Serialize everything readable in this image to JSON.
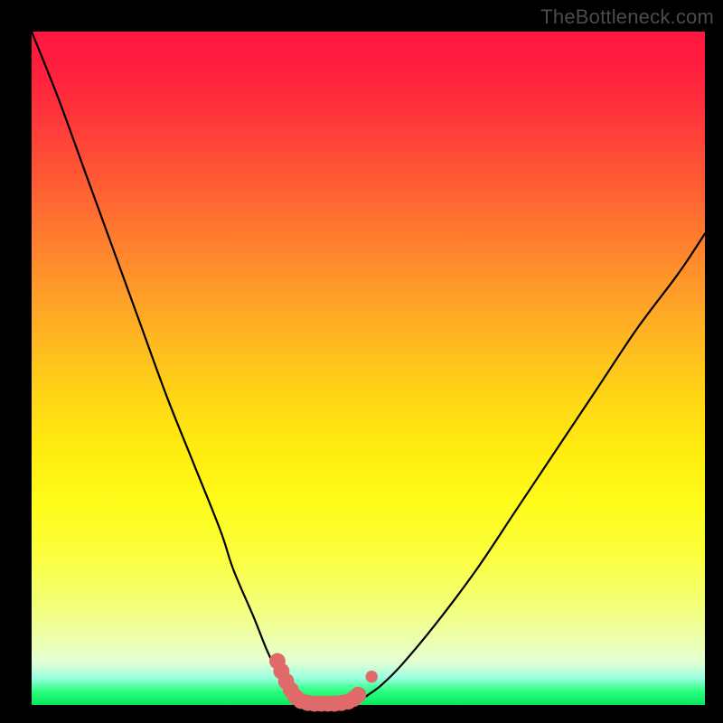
{
  "watermark": {
    "text": "TheBottleneck.com"
  },
  "colors": {
    "curve_stroke": "#000000",
    "marker_stroke": "#e06a6a",
    "marker_fill": "#e06a6a",
    "gradient_top": "#ff173f",
    "gradient_bottom": "#08e85e"
  },
  "chart_data": {
    "type": "line",
    "title": "",
    "xlabel": "",
    "ylabel": "",
    "xlim": [
      0,
      100
    ],
    "ylim": [
      0,
      100
    ],
    "grid": false,
    "legend": false,
    "series": [
      {
        "name": "left-branch",
        "x": [
          0,
          4,
          8,
          12,
          16,
          20,
          24,
          28,
          30,
          33,
          35,
          37,
          38.5,
          39.5
        ],
        "values": [
          100,
          90,
          79,
          68,
          57,
          46,
          36,
          26,
          20,
          13,
          8,
          4,
          1.5,
          0.5
        ]
      },
      {
        "name": "bottom-segment",
        "x": [
          39.5,
          41,
          43,
          45,
          47,
          48.5
        ],
        "values": [
          0.5,
          0,
          0,
          0,
          0,
          0.5
        ]
      },
      {
        "name": "right-branch",
        "x": [
          48.5,
          50,
          52,
          55,
          60,
          66,
          72,
          78,
          84,
          90,
          96,
          100
        ],
        "values": [
          0.5,
          1.5,
          3,
          6,
          12,
          20,
          29,
          38,
          47,
          56,
          64,
          70
        ]
      }
    ],
    "markers": {
      "name": "highlighted-points",
      "points": [
        {
          "x": 36.5,
          "y": 6.5,
          "r": 1.2
        },
        {
          "x": 37.1,
          "y": 5.0,
          "r": 1.2
        },
        {
          "x": 37.8,
          "y": 3.5,
          "r": 1.2
        },
        {
          "x": 38.5,
          "y": 2.2,
          "r": 1.2
        },
        {
          "x": 39.2,
          "y": 1.2,
          "r": 1.2
        },
        {
          "x": 40.0,
          "y": 0.6,
          "r": 1.2
        },
        {
          "x": 41.0,
          "y": 0.3,
          "r": 1.2
        },
        {
          "x": 42.0,
          "y": 0.2,
          "r": 1.2
        },
        {
          "x": 43.0,
          "y": 0.2,
          "r": 1.2
        },
        {
          "x": 44.0,
          "y": 0.2,
          "r": 1.2
        },
        {
          "x": 45.0,
          "y": 0.2,
          "r": 1.2
        },
        {
          "x": 46.0,
          "y": 0.3,
          "r": 1.2
        },
        {
          "x": 47.0,
          "y": 0.5,
          "r": 1.2
        },
        {
          "x": 47.8,
          "y": 0.9,
          "r": 1.2
        },
        {
          "x": 48.5,
          "y": 1.5,
          "r": 1.2
        },
        {
          "x": 50.5,
          "y": 4.2,
          "r": 0.9
        }
      ]
    }
  }
}
